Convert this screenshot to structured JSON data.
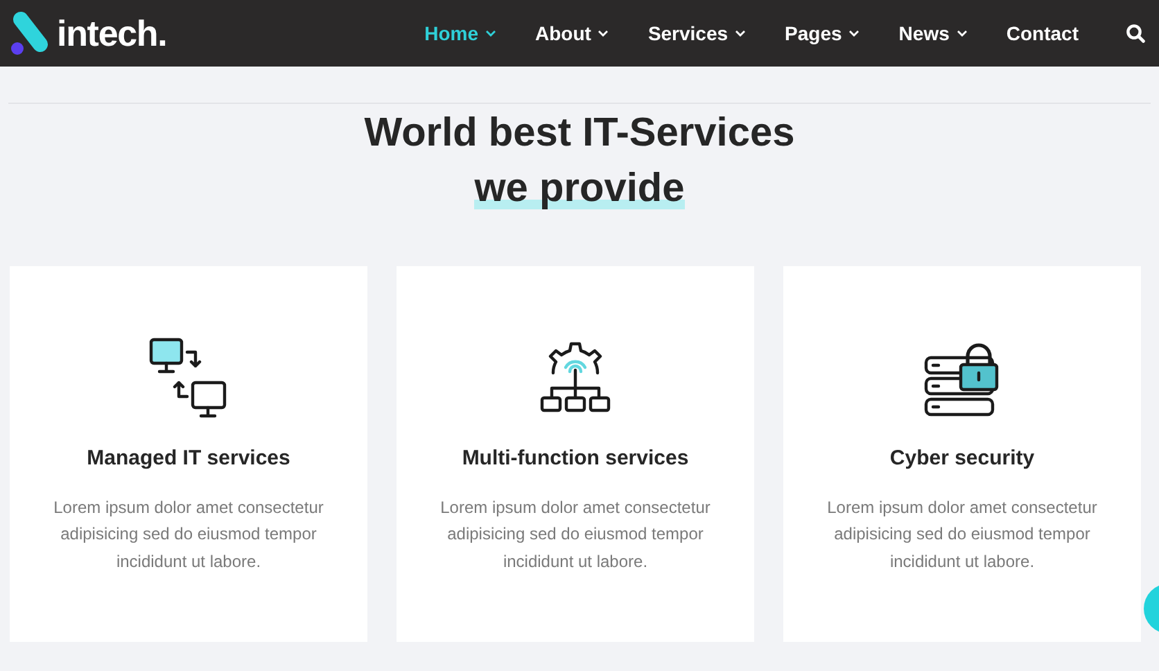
{
  "brand": {
    "name": "intech."
  },
  "nav": [
    {
      "label": "Home",
      "selected": true,
      "dropdown": true
    },
    {
      "label": "About",
      "selected": false,
      "dropdown": true
    },
    {
      "label": "Services",
      "selected": false,
      "dropdown": true
    },
    {
      "label": "Pages",
      "selected": false,
      "dropdown": true
    },
    {
      "label": "News",
      "selected": false,
      "dropdown": true
    },
    {
      "label": "Contact",
      "selected": false,
      "dropdown": false
    }
  ],
  "heading": {
    "line_1": "World best IT-Services",
    "line_2": "we provide"
  },
  "cards": [
    {
      "kind": "monitors",
      "title": "Managed IT services",
      "text": "Lorem ipsum dolor amet consectetur adipisicing sed do eiusmod tempor incididunt ut labore."
    },
    {
      "kind": "network",
      "title": "Multi-function services",
      "text": "Lorem ipsum dolor amet consectetur adipisicing sed do eiusmod tempor incididunt ut labore."
    },
    {
      "kind": "lock",
      "title": "Cyber security",
      "text": "Lorem ipsum dolor amet consectetur adipisicing sed do eiusmod tempor incididunt ut labore."
    }
  ]
}
